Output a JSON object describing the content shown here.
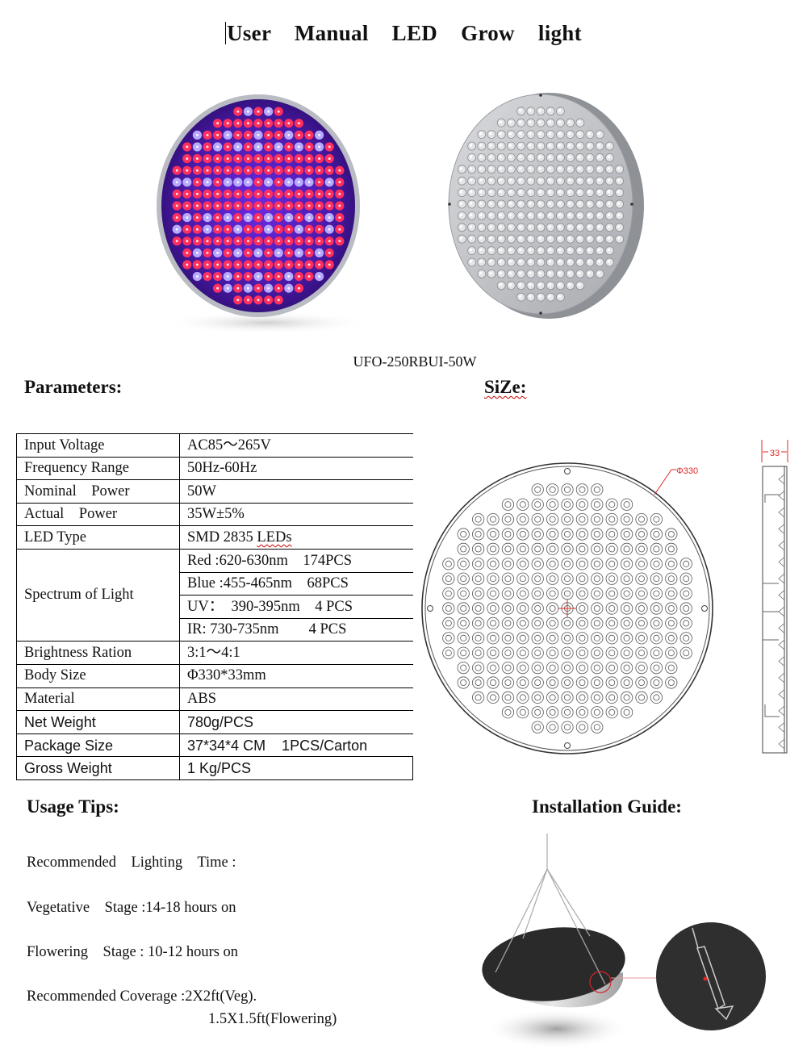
{
  "document": {
    "title": "User Manual LED Grow light",
    "model_caption": "UFO-250RBUI-50W"
  },
  "images": {
    "front_view": {
      "description": "Round UFO LED panel lit with red and blue LEDs",
      "icon": "led-panel-front-image"
    },
    "back_view": {
      "description": "Round silver aluminum LED panel, unlit LED grid",
      "icon": "led-panel-back-image"
    }
  },
  "parameters": {
    "heading": "Parameters:",
    "rows": [
      {
        "label": "Input Voltage",
        "value": "AC85～265V"
      },
      {
        "label": "Frequency Range",
        "value": "50Hz-60Hz"
      },
      {
        "label": "Nominal    Power",
        "value": "50W"
      },
      {
        "label": "Actual    Power",
        "value": "35W±5%"
      },
      {
        "label": "LED Type",
        "value": "SMD 2835 LEDs"
      },
      {
        "label": "Spectrum of Light",
        "values": [
          "Red :620-630nm    174PCS",
          "Blue :455-465nm    68PCS",
          "UV：  390-395nm    4 PCS",
          "IR: 730-735nm        4 PCS"
        ]
      },
      {
        "label": "Brightness Ration",
        "value": "3:1～4:1"
      },
      {
        "label": "Body Size",
        "value": "Φ330*33mm"
      },
      {
        "label": "Material",
        "value": "ABS"
      },
      {
        "label": "Net Weight",
        "value": "780g/PCS"
      },
      {
        "label": "Package Size",
        "value": "37*34*4 CM    1PCS/Carton"
      },
      {
        "label": "Gross Weight",
        "value": "1 Kg/PCS"
      }
    ]
  },
  "size": {
    "heading": "SiZe:",
    "diameter_label": "Φ330",
    "thickness_label": "33",
    "dimension_color": "#e0282a"
  },
  "usage_tips": {
    "heading": "Usage Tips:",
    "lines": [
      "Recommended    Lighting    Time :",
      "Vegetative    Stage :14-18 hours on",
      "Flowering    Stage : 10-12 hours on",
      "Recommended Coverage :2X2ft(Veg).",
      "1.5X1.5ft(Flowering)"
    ]
  },
  "installation_guide": {
    "heading": "Installation Guide:",
    "image": "hanging-kit-image"
  },
  "colors": {
    "led_red": "#ff2f5e",
    "led_blue": "#b6a8ff",
    "panel_purple": "#4a14a8",
    "panel_silver": "#c8cacd",
    "highlight_red": "#d3262c"
  }
}
